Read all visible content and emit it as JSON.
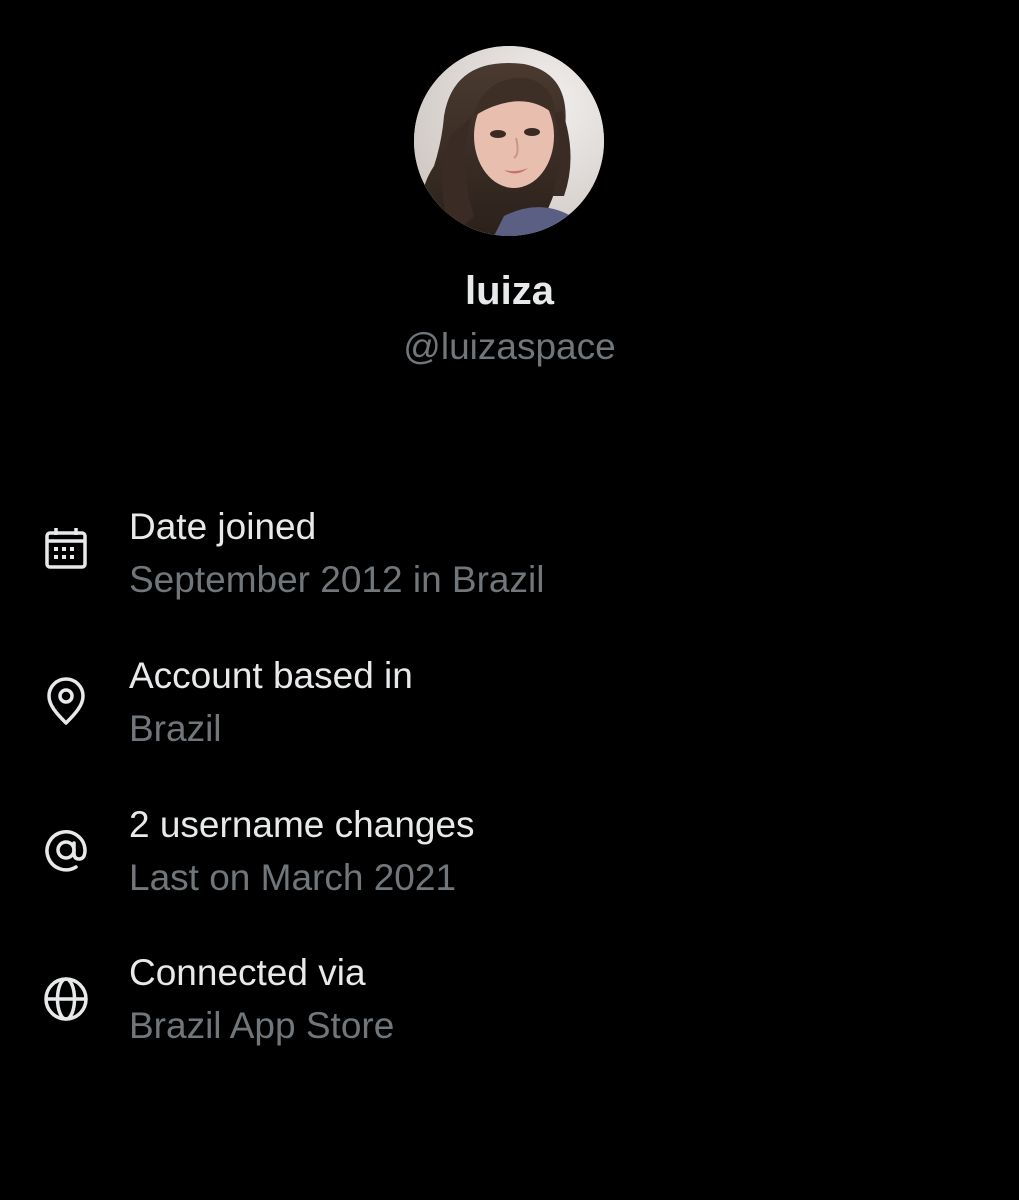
{
  "profile": {
    "display_name": "luiza",
    "handle": "@luizaspace",
    "avatar_alt": "luiza"
  },
  "info": [
    {
      "icon": "calendar-icon",
      "title": "Date joined",
      "subtitle": "September 2012 in Brazil"
    },
    {
      "icon": "location-pin-icon",
      "title": "Account based in",
      "subtitle": "Brazil"
    },
    {
      "icon": "at-sign-icon",
      "title": "2 username changes",
      "subtitle": "Last on March 2021"
    },
    {
      "icon": "globe-icon",
      "title": "Connected via",
      "subtitle": "Brazil App Store"
    }
  ],
  "colors": {
    "background": "#000000",
    "primary_text": "#e7e9ea",
    "secondary_text": "#71767b"
  }
}
